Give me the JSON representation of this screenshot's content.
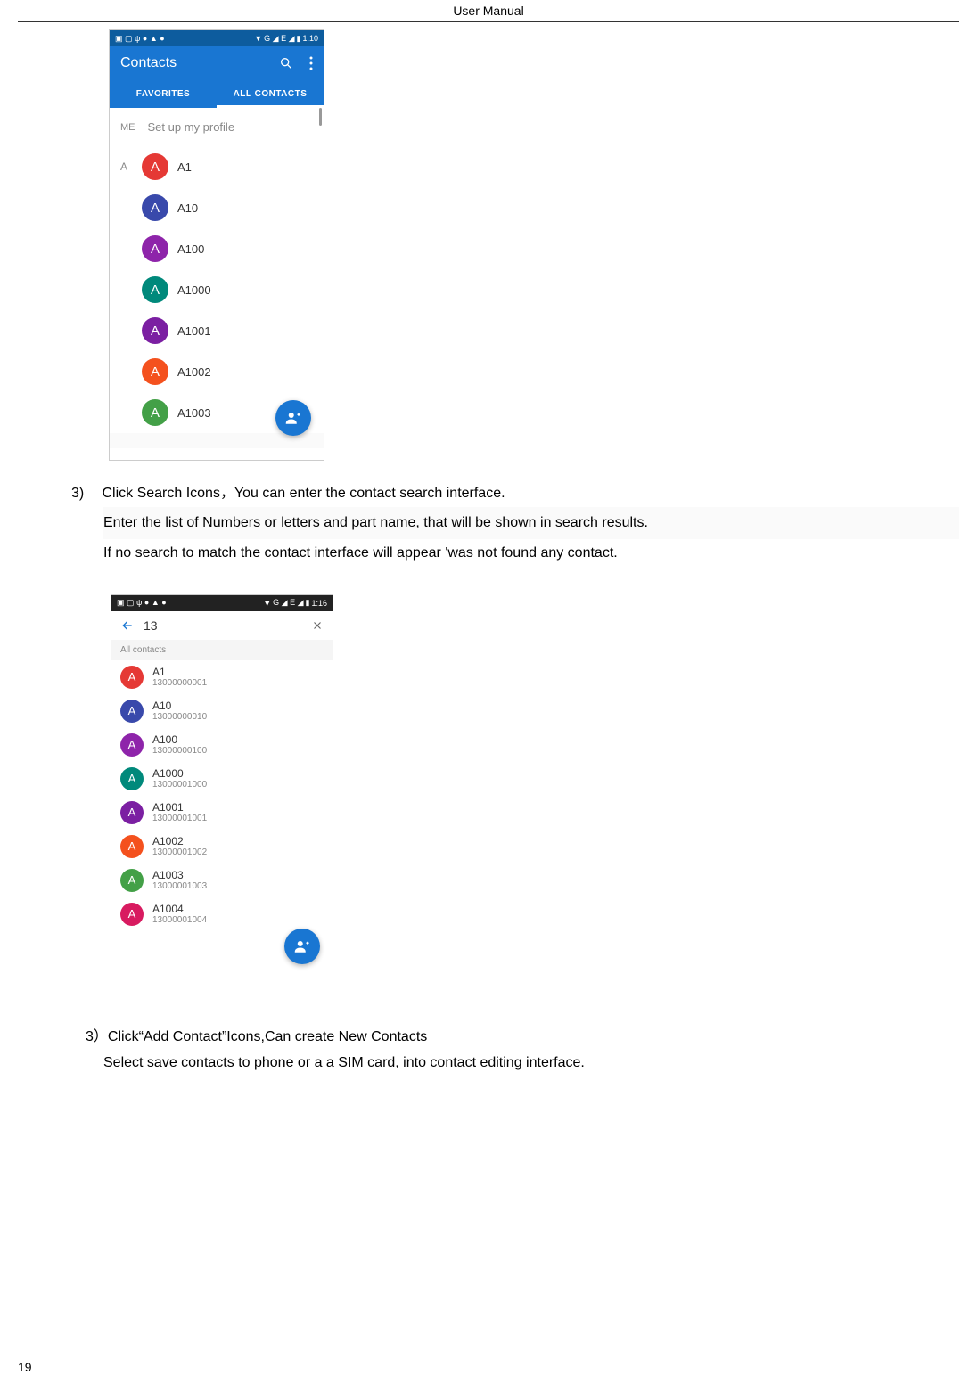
{
  "page": {
    "header": "User    Manual",
    "number": "19"
  },
  "shot1": {
    "status": {
      "time": "1:10",
      "signal": "G ◢ E ◢"
    },
    "appbar": {
      "title": "Contacts"
    },
    "tabs": {
      "fav": "FAVORITES",
      "all": "ALL CONTACTS"
    },
    "me": {
      "label": "ME",
      "text": "Set up my profile"
    },
    "section": "A",
    "contacts": [
      {
        "letter": "A",
        "name": "A1",
        "color": "#e53935"
      },
      {
        "letter": "A",
        "name": "A10",
        "color": "#3949ab"
      },
      {
        "letter": "A",
        "name": "A100",
        "color": "#8e24aa"
      },
      {
        "letter": "A",
        "name": "A1000",
        "color": "#00897b"
      },
      {
        "letter": "A",
        "name": "A1001",
        "color": "#7b1fa2"
      },
      {
        "letter": "A",
        "name": "A1002",
        "color": "#f4511e"
      },
      {
        "letter": "A",
        "name": "A1003",
        "color": "#43a047"
      }
    ]
  },
  "text1": {
    "num": "3)",
    "line1": "Click Search Icons，You can enter the contact search interface.",
    "line2": "Enter the list of Numbers or letters and part name, that will be shown in search results.",
    "line3": "If no search to match the contact interface will appear 'was not found any contact."
  },
  "shot2": {
    "status": {
      "time": "1:16",
      "signal": "G ◢ E ◢"
    },
    "search": {
      "query": "13"
    },
    "label": "All contacts",
    "results": [
      {
        "letter": "A",
        "name": "A1",
        "num": "13000000001",
        "color": "#e53935"
      },
      {
        "letter": "A",
        "name": "A10",
        "num": "13000000010",
        "color": "#3949ab"
      },
      {
        "letter": "A",
        "name": "A100",
        "num": "13000000100",
        "color": "#8e24aa"
      },
      {
        "letter": "A",
        "name": "A1000",
        "num": "13000001000",
        "color": "#00897b"
      },
      {
        "letter": "A",
        "name": "A1001",
        "num": "13000001001",
        "color": "#7b1fa2"
      },
      {
        "letter": "A",
        "name": "A1002",
        "num": "13000001002",
        "color": "#f4511e"
      },
      {
        "letter": "A",
        "name": "A1003",
        "num": "13000001003",
        "color": "#43a047"
      },
      {
        "letter": "A",
        "name": "A1004",
        "num": "13000001004",
        "color": "#d81b60"
      }
    ]
  },
  "text2": {
    "line1": "3）Click“Add    Contact”Icons,Can create New Contacts",
    "line2": "Select save contacts to phone or a a SIM card, into contact editing interface."
  }
}
